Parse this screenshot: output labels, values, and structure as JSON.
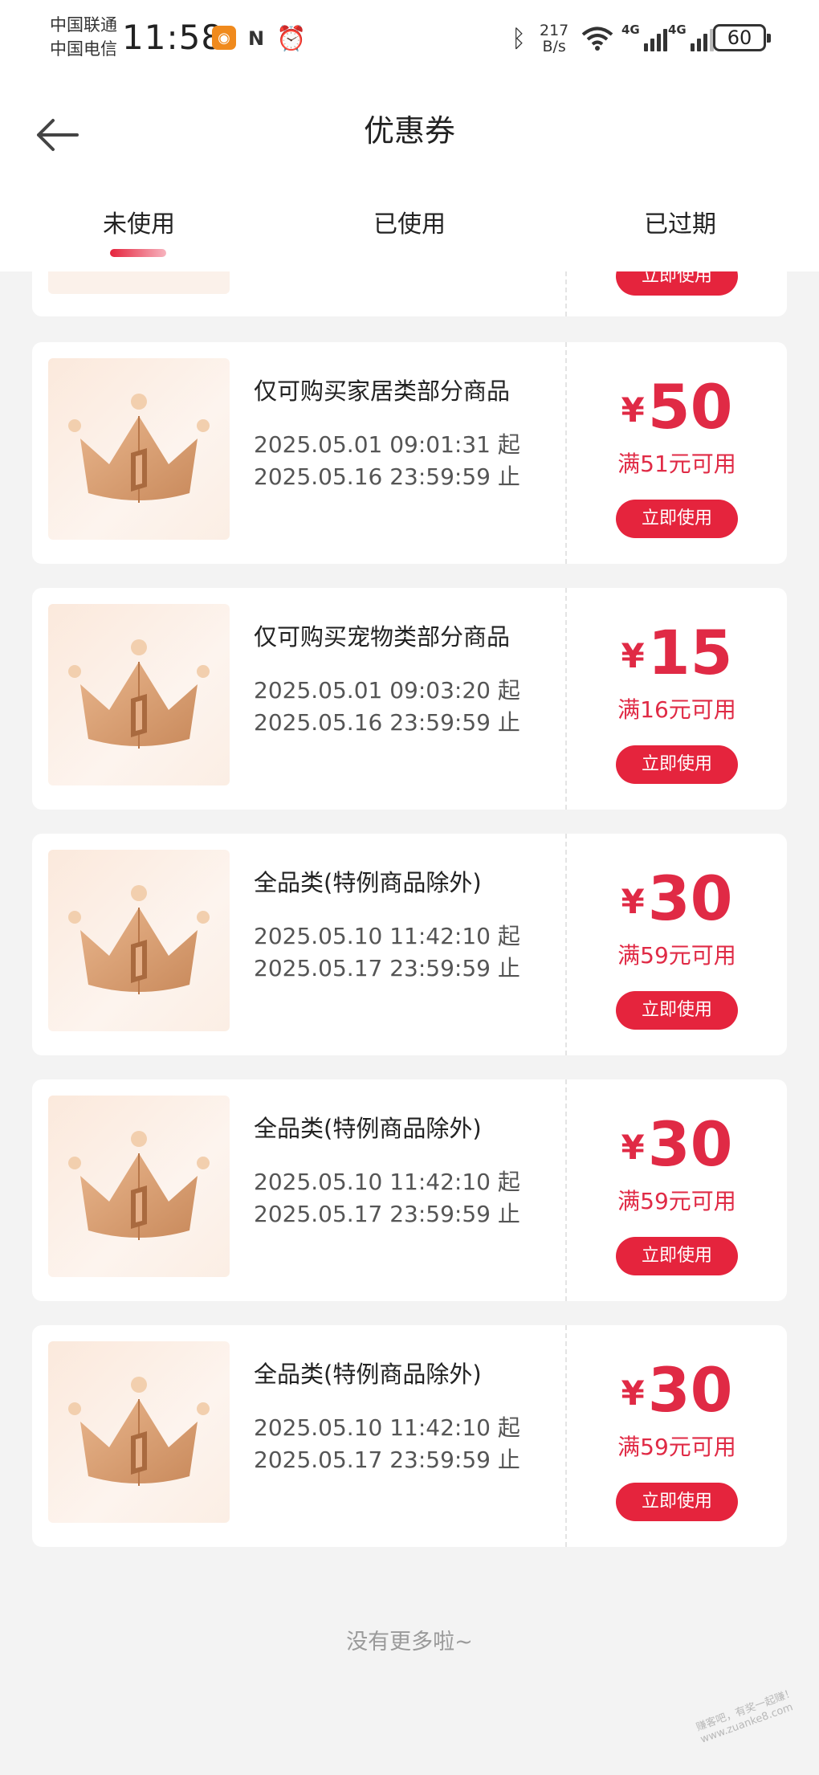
{
  "status_bar": {
    "carrier_1": "中国联通",
    "carrier_2": "中国电信",
    "time": "11:58",
    "net_speed_value": "217",
    "net_speed_unit": "B/s",
    "net_1": "4G",
    "net_2": "4G",
    "battery": "60"
  },
  "header": {
    "title": "优惠券",
    "back_icon": "arrow-left-icon"
  },
  "tabs": [
    {
      "label": "未使用",
      "active": true
    },
    {
      "label": "已使用",
      "active": false
    },
    {
      "label": "已过期",
      "active": false
    }
  ],
  "colors": {
    "accent": "#e5243d",
    "amount": "#e02a45",
    "page_bg": "#f3f3f3"
  },
  "partial_coupon": {
    "button": "立即使用"
  },
  "coupons": [
    {
      "name": "仅可购买家居类部分商品",
      "start": "2025.05.01 09:01:31 起",
      "end": "2025.05.16 23:59:59 止",
      "currency": "¥",
      "amount": "50",
      "condition": "满51元可用",
      "button": "立即使用"
    },
    {
      "name": "仅可购买宠物类部分商品",
      "start": "2025.05.01 09:03:20 起",
      "end": "2025.05.16 23:59:59 止",
      "currency": "¥",
      "amount": "15",
      "condition": "满16元可用",
      "button": "立即使用"
    },
    {
      "name": "全品类(特例商品除外)",
      "start": "2025.05.10 11:42:10 起",
      "end": "2025.05.17 23:59:59 止",
      "currency": "¥",
      "amount": "30",
      "condition": "满59元可用",
      "button": "立即使用"
    },
    {
      "name": "全品类(特例商品除外)",
      "start": "2025.05.10 11:42:10 起",
      "end": "2025.05.17 23:59:59 止",
      "currency": "¥",
      "amount": "30",
      "condition": "满59元可用",
      "button": "立即使用"
    },
    {
      "name": "全品类(特例商品除外)",
      "start": "2025.05.10 11:42:10 起",
      "end": "2025.05.17 23:59:59 止",
      "currency": "¥",
      "amount": "30",
      "condition": "满59元可用",
      "button": "立即使用"
    }
  ],
  "footer": {
    "no_more": "没有更多啦~"
  },
  "watermark": "赚客吧，有奖一起赚！ www.zuanke8.com"
}
